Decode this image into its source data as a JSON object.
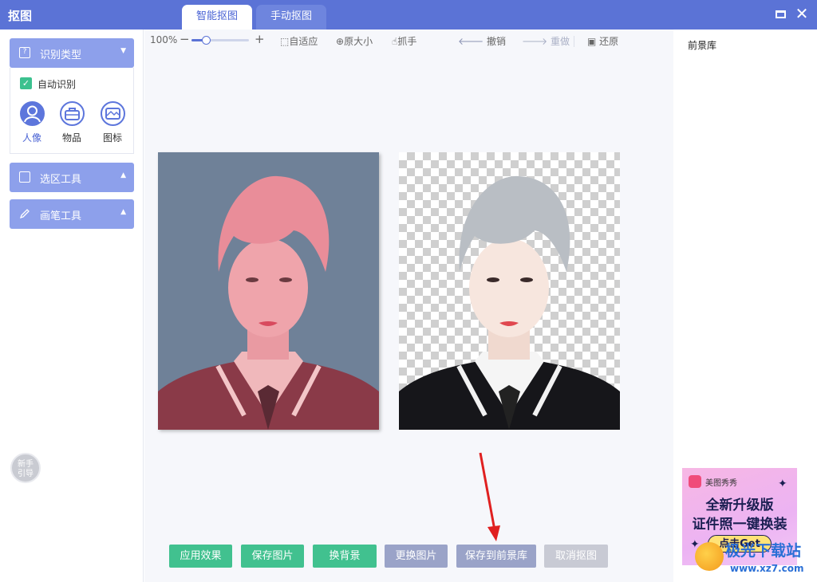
{
  "app": {
    "title": "抠图"
  },
  "tabs": [
    {
      "label": "智能抠图",
      "active": true
    },
    {
      "label": "手动抠图",
      "active": false
    }
  ],
  "left_panel": {
    "recognize": {
      "label": "识别类型",
      "auto_label": "自动识别",
      "auto_checked": true,
      "types": [
        {
          "label": "人像",
          "icon": "person-icon",
          "active": true
        },
        {
          "label": "物品",
          "icon": "bag-icon",
          "active": false
        },
        {
          "label": "图标",
          "icon": "image-icon",
          "active": false
        }
      ]
    },
    "select_tool": {
      "label": "选区工具"
    },
    "brush_tool": {
      "label": "画笔工具"
    },
    "guide": {
      "line1": "新手",
      "line2": "引导"
    }
  },
  "toolbar": {
    "zoom_label": "100%",
    "zoom_value": 0.25,
    "fit_label": "自适应",
    "original_size_label": "原大小",
    "hand_label": "抓手",
    "undo_label": "撤销",
    "redo_label": "重做",
    "restore_label": "还原"
  },
  "buttons": {
    "apply": "应用效果",
    "save_image": "保存图片",
    "change_bg": "换背景",
    "replace_image": "更换图片",
    "save_to_library": "保存到前景库",
    "cancel": "取消抠图"
  },
  "right_panel": {
    "title": "前景库",
    "ad": {
      "brand": "美图秀秀",
      "line1": "全新升级版",
      "line2": "证件照一键换装",
      "cta": "点击Get"
    }
  },
  "watermark": {
    "name": "极光下载站",
    "url": "www.xz7.com"
  },
  "colors": {
    "accent": "#5b73d6",
    "green": "#41c18f",
    "panel": "#8da0eb",
    "arrow": "#e02020"
  }
}
